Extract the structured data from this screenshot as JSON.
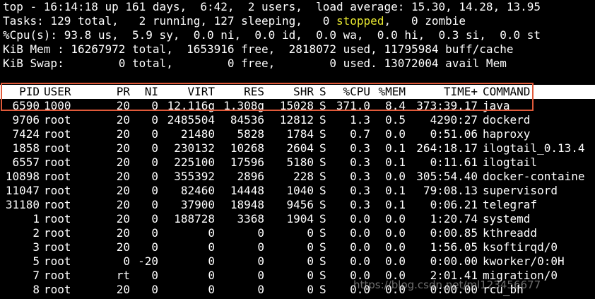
{
  "summary": {
    "line1": "top - 16:14:18 up 161 days,  6:42,  2 users,  load average: 15.30, 14.28, 13.95",
    "line2_pre": "Tasks: 129 total,   2 running, 127 sleeping,   0 ",
    "line2_stopped": "stopped",
    "line2_post": ",   0 zombie",
    "line3": "%Cpu(s): 93.8 us,  5.9 sy,  0.0 ni,  0.0 id,  0.0 wa,  0.0 hi,  0.3 si,  0.0 st",
    "line4": "KiB Mem : 16267972 total,  1653916 free,  2818072 used, 11795984 buff/cache",
    "line5": "KiB Swap:        0 total,        0 free,        0 used. 13072004 avail Mem"
  },
  "columns": {
    "pid": "PID",
    "user": "USER",
    "pr": "PR",
    "ni": "NI",
    "virt": "VIRT",
    "res": "RES",
    "shr": "SHR",
    "s": "S",
    "cpu": "%CPU",
    "mem": "%MEM",
    "time": "TIME+",
    "command": "COMMAND"
  },
  "processes": [
    {
      "pid": "6590",
      "user": "1000",
      "pr": "20",
      "ni": "0",
      "virt": "12.116g",
      "res": "1.308g",
      "shr": "15028",
      "s": "S",
      "cpu": "371.0",
      "mem": "8.4",
      "time": "373:39.17",
      "command": "java"
    },
    {
      "pid": "9706",
      "user": "root",
      "pr": "20",
      "ni": "0",
      "virt": "2485504",
      "res": "84536",
      "shr": "12812",
      "s": "S",
      "cpu": "1.3",
      "mem": "0.5",
      "time": "4290:27",
      "command": "dockerd"
    },
    {
      "pid": "7424",
      "user": "root",
      "pr": "20",
      "ni": "0",
      "virt": "21480",
      "res": "5828",
      "shr": "1784",
      "s": "S",
      "cpu": "0.7",
      "mem": "0.0",
      "time": "0:51.06",
      "command": "haproxy"
    },
    {
      "pid": "1858",
      "user": "root",
      "pr": "20",
      "ni": "0",
      "virt": "230132",
      "res": "10268",
      "shr": "2604",
      "s": "S",
      "cpu": "0.3",
      "mem": "0.1",
      "time": "264:18.17",
      "command": "ilogtail_0.13.4"
    },
    {
      "pid": "6557",
      "user": "root",
      "pr": "20",
      "ni": "0",
      "virt": "225100",
      "res": "17596",
      "shr": "5180",
      "s": "S",
      "cpu": "0.3",
      "mem": "0.1",
      "time": "0:11.61",
      "command": "ilogtail"
    },
    {
      "pid": "10898",
      "user": "root",
      "pr": "20",
      "ni": "0",
      "virt": "355392",
      "res": "2896",
      "shr": "228",
      "s": "S",
      "cpu": "0.3",
      "mem": "0.0",
      "time": "305:54.40",
      "command": "docker-containe"
    },
    {
      "pid": "11047",
      "user": "root",
      "pr": "20",
      "ni": "0",
      "virt": "82460",
      "res": "14448",
      "shr": "1040",
      "s": "S",
      "cpu": "0.3",
      "mem": "0.1",
      "time": "79:08.13",
      "command": "supervisord"
    },
    {
      "pid": "31180",
      "user": "root",
      "pr": "20",
      "ni": "0",
      "virt": "37900",
      "res": "18948",
      "shr": "9456",
      "s": "S",
      "cpu": "0.3",
      "mem": "0.1",
      "time": "0:06.21",
      "command": "telegraf"
    },
    {
      "pid": "1",
      "user": "root",
      "pr": "20",
      "ni": "0",
      "virt": "188728",
      "res": "3368",
      "shr": "1904",
      "s": "S",
      "cpu": "0.0",
      "mem": "0.0",
      "time": "1:20.74",
      "command": "systemd"
    },
    {
      "pid": "2",
      "user": "root",
      "pr": "20",
      "ni": "0",
      "virt": "0",
      "res": "0",
      "shr": "0",
      "s": "S",
      "cpu": "0.0",
      "mem": "0.0",
      "time": "0:00.85",
      "command": "kthreadd"
    },
    {
      "pid": "3",
      "user": "root",
      "pr": "20",
      "ni": "0",
      "virt": "0",
      "res": "0",
      "shr": "0",
      "s": "S",
      "cpu": "0.0",
      "mem": "0.0",
      "time": "1:56.05",
      "command": "ksoftirqd/0"
    },
    {
      "pid": "5",
      "user": "root",
      "pr": "0",
      "ni": "-20",
      "virt": "0",
      "res": "0",
      "shr": "0",
      "s": "S",
      "cpu": "0.0",
      "mem": "0.0",
      "time": "0:00.00",
      "command": "kworker/0:0H"
    },
    {
      "pid": "7",
      "user": "root",
      "pr": "rt",
      "ni": "0",
      "virt": "0",
      "res": "0",
      "shr": "0",
      "s": "S",
      "cpu": "0.0",
      "mem": "0.0",
      "time": "2:01.41",
      "command": "migration/0"
    },
    {
      "pid": "8",
      "user": "root",
      "pr": "20",
      "ni": "0",
      "virt": "0",
      "res": "0",
      "shr": "0",
      "s": "S",
      "cpu": "0.0",
      "mem": "0.0",
      "time": "0:00.00",
      "command": "rcu_bh"
    }
  ],
  "watermark": "https://blog.csdn.net/ml123456677",
  "colors": {
    "background": "#000000",
    "text": "#ffffff",
    "stopped": "#e8e830",
    "highlight": "#e05a3a"
  }
}
